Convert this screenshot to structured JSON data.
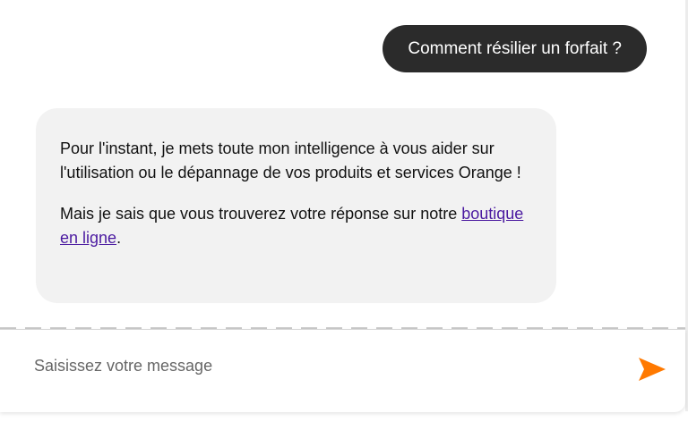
{
  "conversation": {
    "user_message": "Comment résilier un forfait ?",
    "bot_message": {
      "paragraph1": "Pour l'instant, je mets toute mon intelligence à vous aider sur l'utilisation ou le dépannage de vos produits et services Orange !",
      "paragraph2_text": "Mais je sais que vous trouverez votre réponse sur notre ",
      "paragraph2_link": "boutique en ligne",
      "paragraph2_end": "."
    }
  },
  "composer": {
    "placeholder": "Saisissez votre message",
    "value": "",
    "send_icon": "send-icon"
  },
  "colors": {
    "accent": "#ff7900",
    "user_bubble": "#2b2b2b",
    "bot_bubble": "#f2f2f2",
    "link": "#4b1aa0"
  }
}
